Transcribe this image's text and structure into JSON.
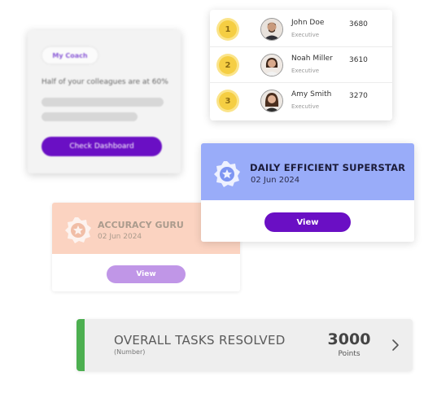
{
  "coach": {
    "chip_label": "My Coach",
    "message": "Half of your colleagues are at 60%",
    "button_label": "Check Dashboard"
  },
  "leaderboard": {
    "rows": [
      {
        "rank": "1",
        "name": "John Doe",
        "role": "Executive",
        "score": "3680"
      },
      {
        "rank": "2",
        "name": "Noah Miller",
        "role": "Executive",
        "score": "3610"
      },
      {
        "rank": "3",
        "name": "Amy Smith",
        "role": "Executive",
        "score": "3270"
      }
    ]
  },
  "badges": [
    {
      "title": "DAILY EFFICIENT SUPERSTAR",
      "date": "02 Jun 2024",
      "button_label": "View",
      "icon": "star-badge-icon",
      "color": "#99acf9"
    },
    {
      "title": "ACCURACY GURU",
      "date": "02 Jun 2024",
      "button_label": "View",
      "icon": "star-badge-icon",
      "color": "#fbd0bc"
    }
  ],
  "tasks": {
    "title": "OVERALL TASKS RESOLVED",
    "subtitle": "(Number)",
    "value": "3000",
    "unit": "Points",
    "accent_color": "#4caf50",
    "icon": "chevron-right-icon"
  }
}
